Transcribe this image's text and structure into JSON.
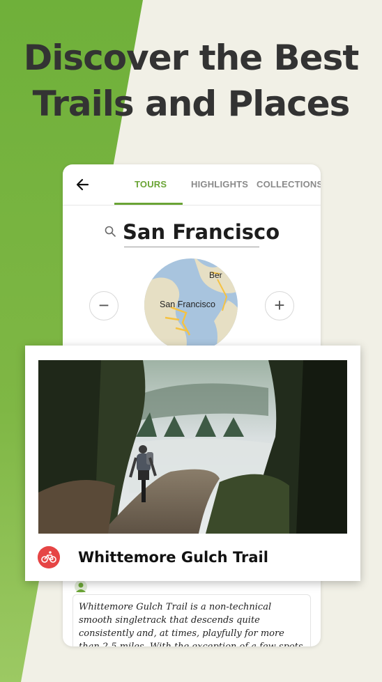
{
  "headline": {
    "line1": "Discover the Best",
    "line2": "Trails and Places"
  },
  "tabs": [
    {
      "label": "TOURS",
      "active": true
    },
    {
      "label": "HIGHLIGHTS",
      "active": false
    },
    {
      "label": "COLLECTIONS",
      "active": false
    }
  ],
  "search": {
    "value": "San Francisco"
  },
  "map": {
    "label": "San Francisco",
    "label_partial": "Ber"
  },
  "zoom": {
    "minus": "−",
    "plus": "+"
  },
  "trail": {
    "name": "Whittemore Gulch Trail",
    "sport_icon": "mountain-bike-icon"
  },
  "description": "Whittemore Gulch Trail is a non-technical smooth singletrack that descends quite consistently and, at times, playfully for more than 2.5 miles. With the exception of a few spots, it's not a very narrow trail and shouldn't be",
  "colors": {
    "accent": "#6aa435",
    "background": "#f1f0e6",
    "sport_badge": "#e64545"
  },
  "icons": [
    "back-arrow-icon",
    "search-icon",
    "mountain-bike-icon"
  ]
}
